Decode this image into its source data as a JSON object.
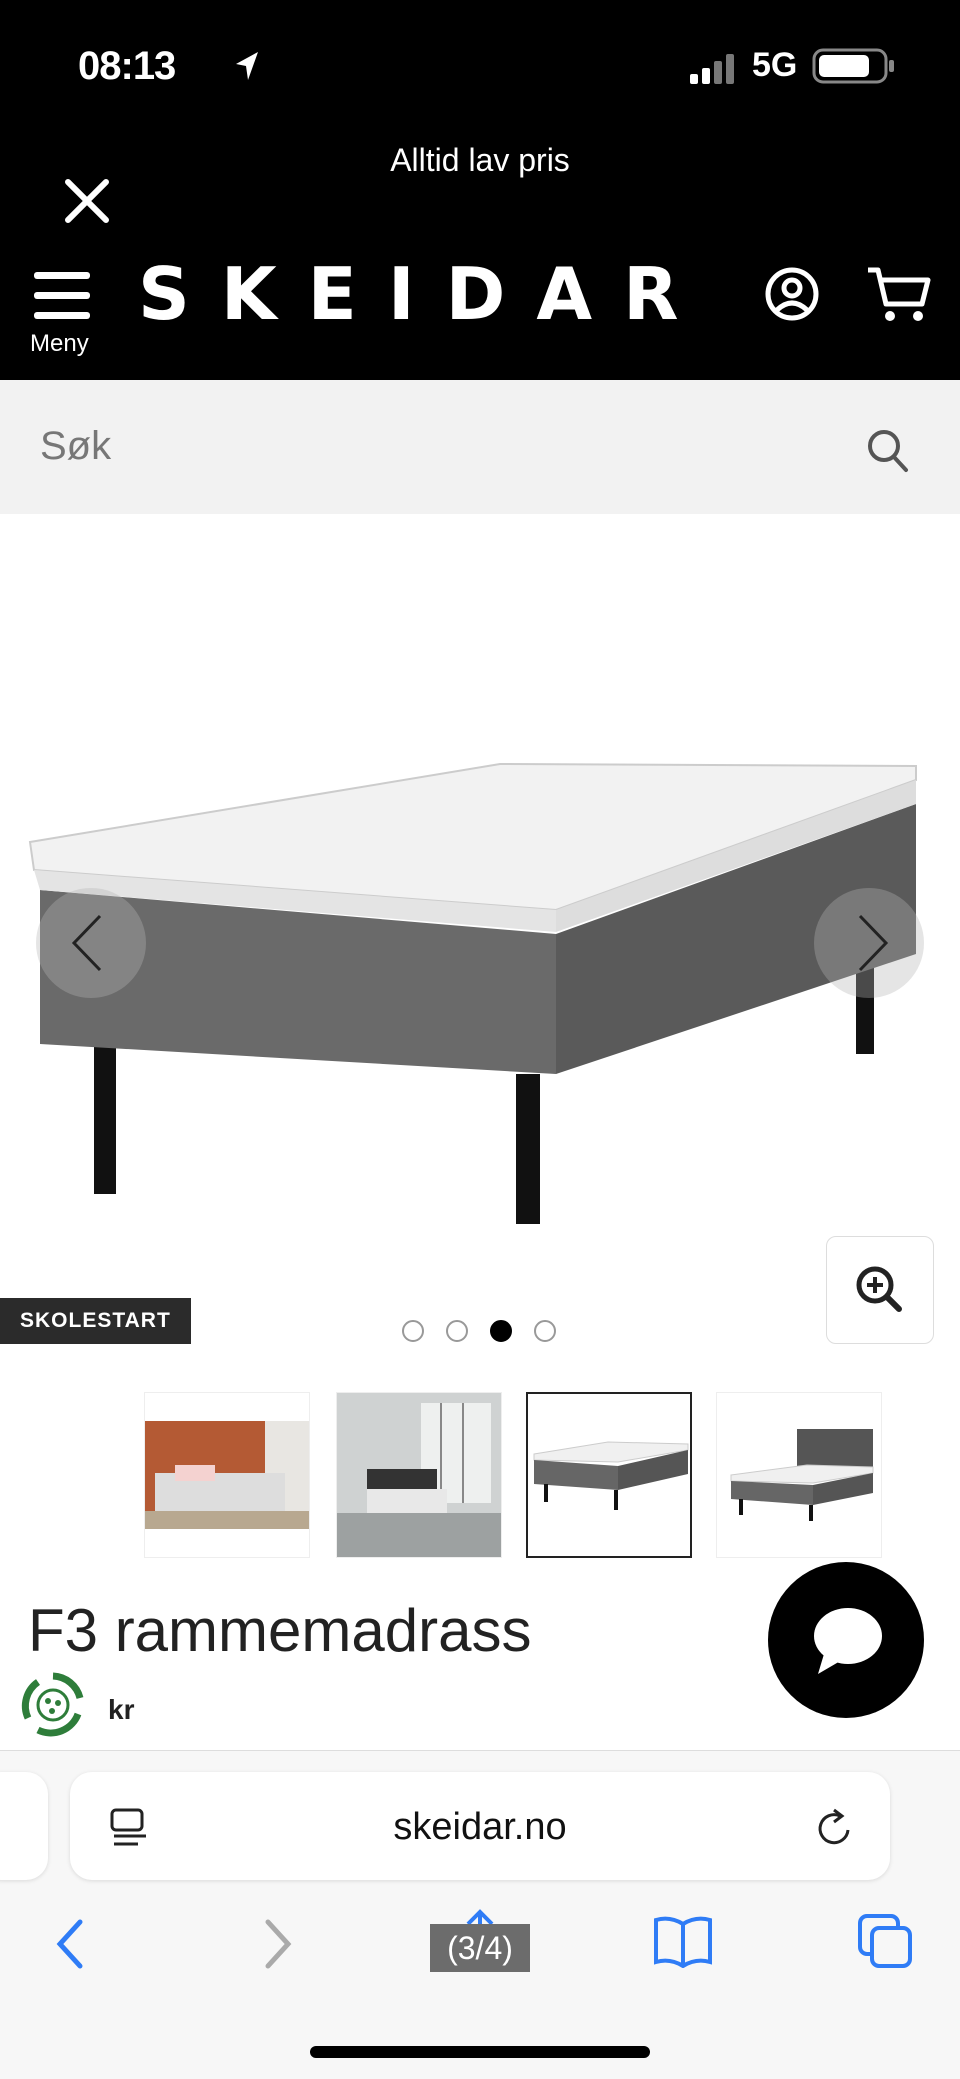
{
  "status_bar": {
    "time": "08:13",
    "network": "5G"
  },
  "header": {
    "promo_text": "Alltid lav pris",
    "logo_text": "SKEIDAR",
    "menu_label": "Meny"
  },
  "search": {
    "placeholder": "Søk"
  },
  "product": {
    "badge": "SKOLESTART",
    "title": "F3 rammemadrass",
    "price_currency": "kr",
    "image_count": 4,
    "active_image_index": 3
  },
  "safari": {
    "url": "skeidar.no",
    "page_counter": "(3/4)"
  },
  "colors": {
    "header_bg": "#000000",
    "search_bg": "#f2f2f2",
    "safari_blue": "#2f7cf6"
  }
}
